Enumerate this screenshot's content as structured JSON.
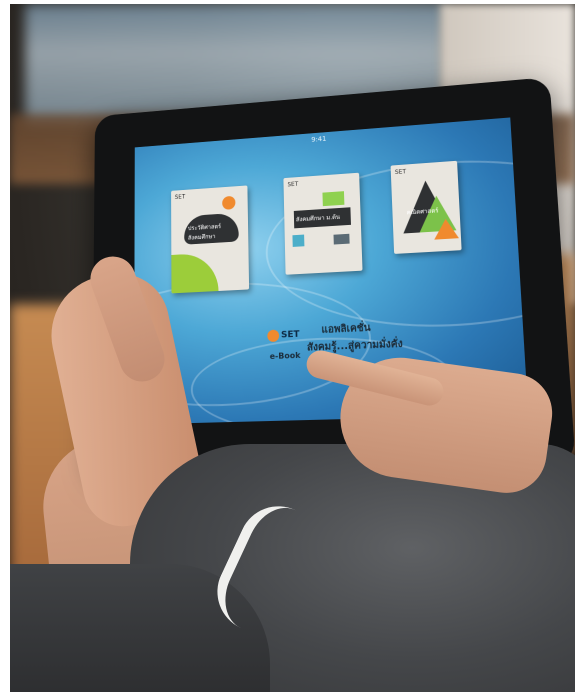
{
  "tablet_screen": {
    "status_time": "9:41",
    "books": [
      {
        "title": "ประวัติศาสตร์ สังคมศึกษา",
        "badge": "SET"
      },
      {
        "title": "สังคมศึกษา ม.ต้น",
        "badge": "SET"
      },
      {
        "title": "คณิตศาสตร์",
        "badge": "SET"
      }
    ],
    "brand": "SET",
    "tagline_line1": "แอพลิเคชั่น",
    "tagline_line2": "สังคมรู้...สู่ความมั่งคั่ง",
    "subline": "e-Book"
  }
}
